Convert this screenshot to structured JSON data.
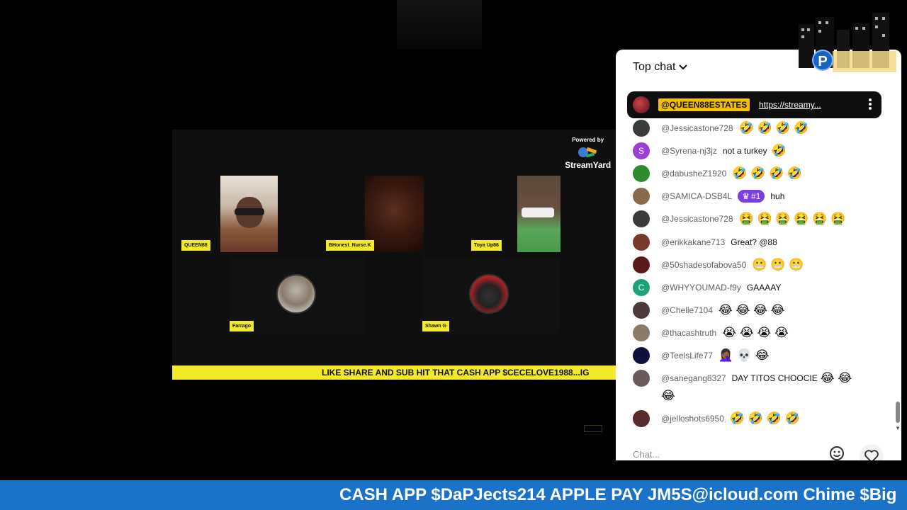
{
  "stage": {
    "powered_by": "Powered by",
    "brand": "StreamYard",
    "participants": [
      {
        "name": "QUEEN88"
      },
      {
        "name": "BHonest_Nurse.K"
      },
      {
        "name": "Toya Up86"
      },
      {
        "name": "Farrago"
      },
      {
        "name": "Shawn G"
      }
    ],
    "ticker": "LIKE SHARE AND SUB HIT THAT CASH APP $CECELOVE1988...IG"
  },
  "chat": {
    "header": "Top chat",
    "pinned": {
      "author": "@QUEEN88ESTATES",
      "link": "https://streamy..."
    },
    "messages": [
      {
        "author": "@Jessicastone728",
        "text": "",
        "emojis": "🤣 🤣 🤣 🤣",
        "avatar_color": "#3b3b3b"
      },
      {
        "author": "@Syrena-nj3jz",
        "text": "not a turkey",
        "emojis": "🤣",
        "avatar_letter": "S",
        "avatar_color": "#9c3fd6"
      },
      {
        "author": "@dabusheZ1920",
        "text": "",
        "emojis": "🤣 🤣 🤣 🤣",
        "avatar_color": "#2e8b2e"
      },
      {
        "author": "@SAMICA-DSB4L",
        "badge": "#1",
        "text": "huh",
        "emojis": "",
        "avatar_color": "#8a6a4a"
      },
      {
        "author": "@Jessicastone728",
        "text": "",
        "emojis": "🤮 🤮 🤮 🤮 🤮 🤮",
        "avatar_color": "#3b3b3b"
      },
      {
        "author": "@erikkakane713",
        "text": "Great? @88",
        "emojis": "",
        "avatar_color": "#7a3a2a"
      },
      {
        "author": "@50shadesofabova50",
        "text": "",
        "emojis": "😬 😬 😬",
        "avatar_color": "#5a1a1a"
      },
      {
        "author": "@WHYYOUMAD-f9y",
        "text": "GAAAAY",
        "emojis": "",
        "avatar_letter": "C",
        "avatar_color": "#1aa37a"
      },
      {
        "author": "@Chelle7104",
        "text": "",
        "emojis": "😂 😂 😂 😂",
        "avatar_color": "#4a3a3a"
      },
      {
        "author": "@thacashtruth",
        "text": "",
        "emojis": "😭 😭 😭 😭",
        "avatar_color": "#8a7a6a"
      },
      {
        "author": "@TeelsLife77",
        "text": "",
        "emojis": "🤦🏾‍♀️ 💀 😂",
        "avatar_color": "#101040"
      },
      {
        "author": "@sanegang8327",
        "text": "DAY TITOS CHOOCIE",
        "emojis": "😂 😂",
        "avatar_color": "#6a5a5a"
      },
      {
        "author": "",
        "text": "",
        "emojis": "😂",
        "avatar_color": ""
      },
      {
        "author": "@jelloshots6950",
        "text": "",
        "emojis": "🤣 🤣 🤣 🤣",
        "avatar_color": "#5a2a2a"
      }
    ],
    "input_placeholder": "Chat..."
  },
  "banner": "CASH APP $DaPJects214 APPLE PAY JM5S@icloud.com Chime $Big",
  "colors": {
    "ticker_yellow": "#f3e92a",
    "banner_blue": "#1a73c8",
    "badge_purple": "#7a3ee6",
    "pinned_name_bg": "#f5c000"
  }
}
